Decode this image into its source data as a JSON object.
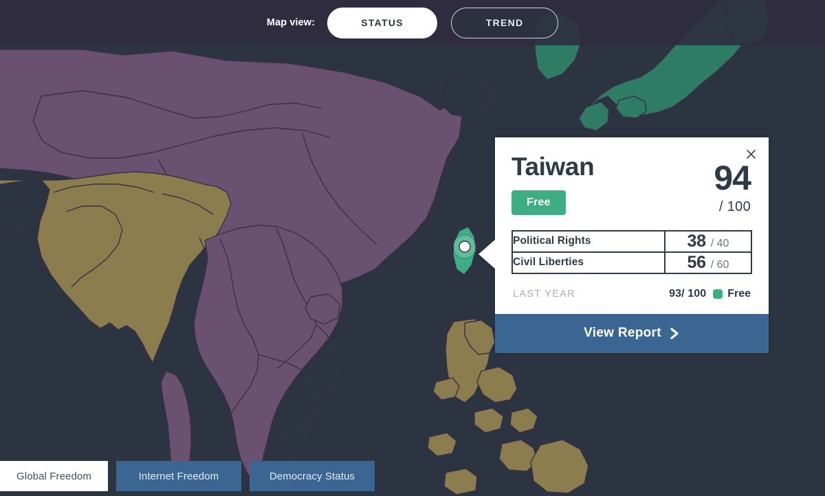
{
  "header": {
    "map_view_label": "Map view:",
    "views": [
      {
        "label": "STATUS",
        "active": true
      },
      {
        "label": "TREND",
        "active": false
      }
    ]
  },
  "callout": {
    "country": "Taiwan",
    "status_badge": "Free",
    "score": "94",
    "score_denominator": "/ 100",
    "close_icon": "close-icon",
    "subscores": [
      {
        "label": "Political Rights",
        "value": "38",
        "denominator": "/ 40"
      },
      {
        "label": "Civil Liberties",
        "value": "56",
        "denominator": "/ 60"
      }
    ],
    "last_year": {
      "label": "LAST YEAR",
      "score": "93",
      "denominator": "/ 100",
      "status": "Free",
      "status_color": "#3DAE83"
    },
    "view_report": {
      "label": "View Report",
      "chevron_icon": "chevron-right-icon"
    }
  },
  "bottom_tabs": [
    {
      "label": "Global Freedom",
      "active": true
    },
    {
      "label": "Internet Freedom",
      "active": false
    },
    {
      "label": "Democracy Status",
      "active": false
    }
  ],
  "map": {
    "ocean_color": "#2B3440",
    "colors": {
      "free": "#2D7C63",
      "partly_free": "#6B5171",
      "not_free": "#8B7D4E",
      "selected": "#3DAE83",
      "border": "#3b2f45"
    },
    "selected_marker": "map-marker-taiwan"
  }
}
